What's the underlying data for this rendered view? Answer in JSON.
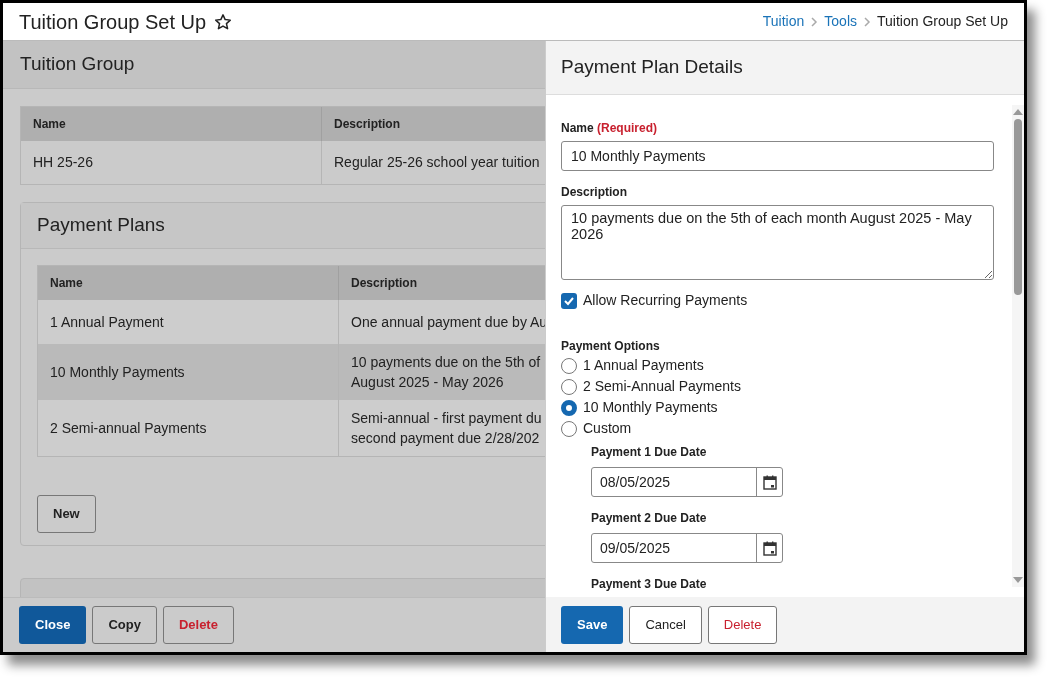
{
  "header": {
    "title": "Tuition Group Set Up",
    "favorite": false,
    "breadcrumbs": [
      {
        "label": "Tuition",
        "link": true
      },
      {
        "label": "Tools",
        "link": true
      },
      {
        "label": "Tuition Group Set Up",
        "link": false
      }
    ]
  },
  "tuition_group": {
    "title": "Tuition Group",
    "columns": [
      "Name",
      "Description"
    ],
    "rows": [
      [
        "HH 25-26",
        "Regular 25-26 school year tuition"
      ]
    ]
  },
  "payment_plans": {
    "title": "Payment Plans",
    "columns": [
      "Name",
      "Description"
    ],
    "rows": [
      {
        "name": "1 Annual Payment",
        "description": [
          "One annual payment due by Au"
        ],
        "selected": false
      },
      {
        "name": "10 Monthly Payments",
        "description": [
          "10 payments due on the 5th of",
          "August 2025 - May 2026"
        ],
        "selected": true
      },
      {
        "name": "2 Semi-annual Payments",
        "description": [
          "Semi-annual - first payment du",
          "second payment due 2/28/202"
        ],
        "selected": false
      }
    ],
    "new_button": "New"
  },
  "footer_buttons": [
    {
      "label": "Close",
      "kind": "primary"
    },
    {
      "label": "Copy",
      "kind": "secondary"
    },
    {
      "label": "Delete",
      "kind": "danger"
    }
  ],
  "detail_panel": {
    "title": "Payment Plan Details",
    "name_label": "Name",
    "name_required": "(Required)",
    "name_value": "10 Monthly Payments",
    "description_label": "Description",
    "description_value": "10 payments due on the 5th of each month August 2025 - May 2026",
    "allow_recurring": {
      "label": "Allow Recurring Payments",
      "checked": true
    },
    "payment_options": {
      "label": "Payment Options",
      "options": [
        {
          "label": "1 Annual Payments",
          "selected": false
        },
        {
          "label": "2 Semi-Annual Payments",
          "selected": false
        },
        {
          "label": "10 Monthly Payments",
          "selected": true
        },
        {
          "label": "Custom",
          "selected": false
        }
      ]
    },
    "due_dates": [
      {
        "label": "Payment 1 Due Date",
        "value": "08/05/2025"
      },
      {
        "label": "Payment 2 Due Date",
        "value": "09/05/2025"
      },
      {
        "label": "Payment 3 Due Date"
      }
    ],
    "footer_buttons": [
      {
        "label": "Save",
        "kind": "primary"
      },
      {
        "label": "Cancel",
        "kind": "secondary"
      },
      {
        "label": "Delete",
        "kind": "danger"
      }
    ]
  }
}
